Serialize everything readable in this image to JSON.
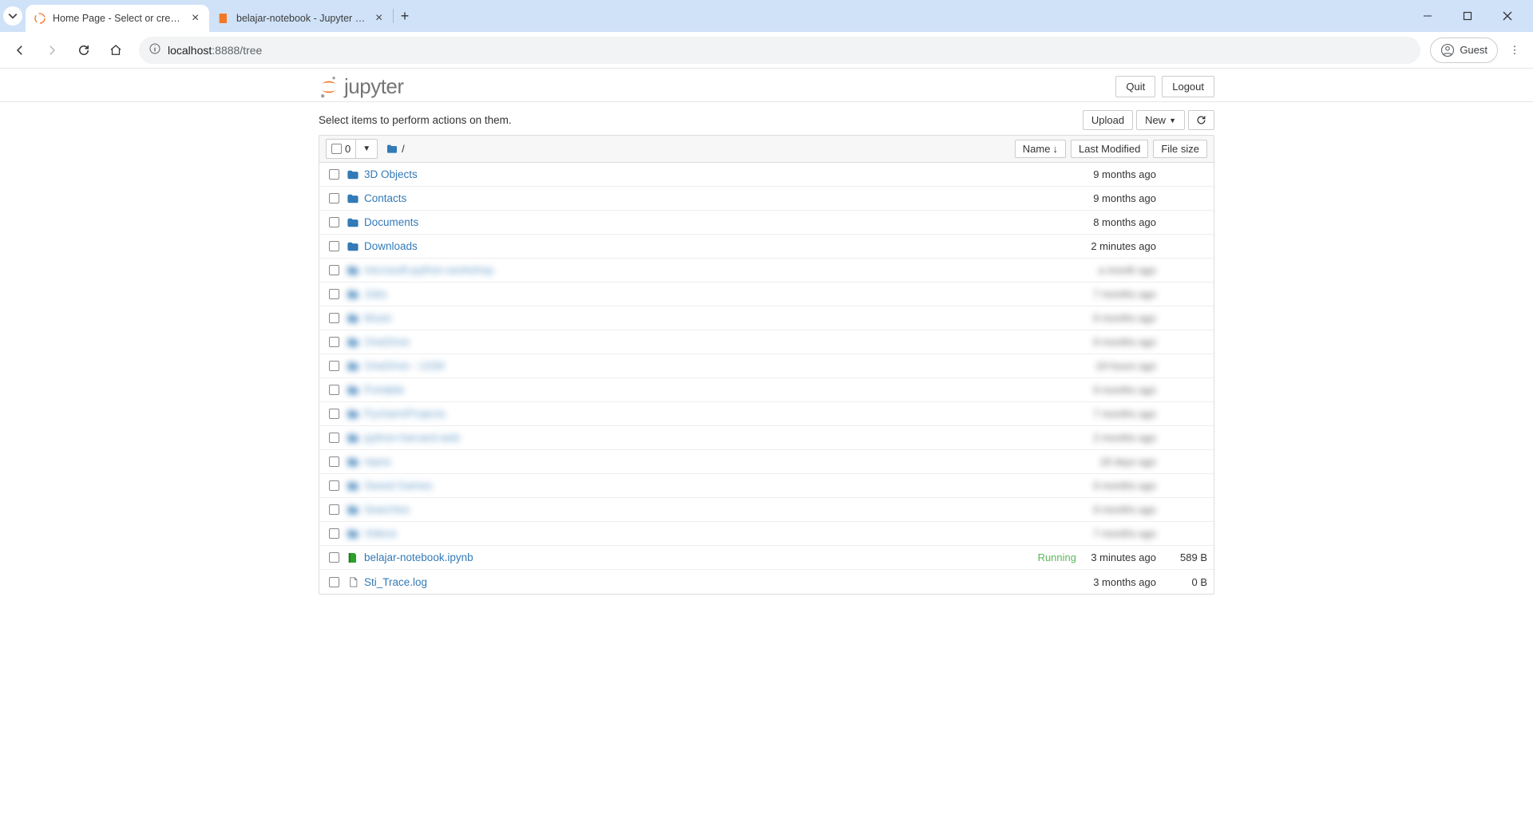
{
  "browser": {
    "tabs": [
      {
        "title": "Home Page - Select or create a",
        "active": true,
        "icon": "jupyter"
      },
      {
        "title": "belajar-notebook - Jupyter Not",
        "active": false,
        "icon": "jupyter-orange"
      }
    ],
    "url_host": "localhost",
    "url_path": ":8888/tree",
    "guest": "Guest"
  },
  "header": {
    "logo_text": "jupyter",
    "quit": "Quit",
    "logout": "Logout"
  },
  "toolbar": {
    "hint": "Select items to perform actions on them.",
    "upload": "Upload",
    "new": "New",
    "select_count": "0",
    "breadcrumb_sep": "/",
    "sort_name": "Name",
    "sort_modified": "Last Modified",
    "sort_size": "File size"
  },
  "rows": [
    {
      "type": "folder",
      "name": "3D Objects",
      "modified": "9 months ago",
      "size": "",
      "status": "",
      "blurred": false
    },
    {
      "type": "folder",
      "name": "Contacts",
      "modified": "9 months ago",
      "size": "",
      "status": "",
      "blurred": false
    },
    {
      "type": "folder",
      "name": "Documents",
      "modified": "8 months ago",
      "size": "",
      "status": "",
      "blurred": false
    },
    {
      "type": "folder",
      "name": "Downloads",
      "modified": "2 minutes ago",
      "size": "",
      "status": "",
      "blurred": false
    },
    {
      "type": "folder",
      "name": "microsoft-python-workshop",
      "modified": "a month ago",
      "size": "",
      "status": "",
      "blurred": true
    },
    {
      "type": "folder",
      "name": "Jobs",
      "modified": "7 months ago",
      "size": "",
      "status": "",
      "blurred": true
    },
    {
      "type": "folder",
      "name": "Music",
      "modified": "9 months ago",
      "size": "",
      "status": "",
      "blurred": true
    },
    {
      "type": "folder",
      "name": "OneDrive",
      "modified": "9 months ago",
      "size": "",
      "status": "",
      "blurred": true
    },
    {
      "type": "folder",
      "name": "OneDrive - UGM",
      "modified": "19 hours ago",
      "size": "",
      "status": "",
      "blurred": true
    },
    {
      "type": "folder",
      "name": "Portable",
      "modified": "9 months ago",
      "size": "",
      "status": "",
      "blurred": true
    },
    {
      "type": "folder",
      "name": "PycharmProjects",
      "modified": "7 months ago",
      "size": "",
      "status": "",
      "blurred": true
    },
    {
      "type": "folder",
      "name": "python-harvard-web",
      "modified": "2 months ago",
      "size": "",
      "status": "",
      "blurred": true
    },
    {
      "type": "folder",
      "name": "repos",
      "modified": "18 days ago",
      "size": "",
      "status": "",
      "blurred": true
    },
    {
      "type": "folder",
      "name": "Saved Games",
      "modified": "9 months ago",
      "size": "",
      "status": "",
      "blurred": true
    },
    {
      "type": "folder",
      "name": "Searches",
      "modified": "9 months ago",
      "size": "",
      "status": "",
      "blurred": true
    },
    {
      "type": "folder",
      "name": "Videos",
      "modified": "7 months ago",
      "size": "",
      "status": "",
      "blurred": true
    },
    {
      "type": "notebook-running",
      "name": "belajar-notebook.ipynb",
      "modified": "3 minutes ago",
      "size": "589 B",
      "status": "Running",
      "blurred": false
    },
    {
      "type": "file",
      "name": "Sti_Trace.log",
      "modified": "3 months ago",
      "size": "0 B",
      "status": "",
      "blurred": false
    }
  ]
}
